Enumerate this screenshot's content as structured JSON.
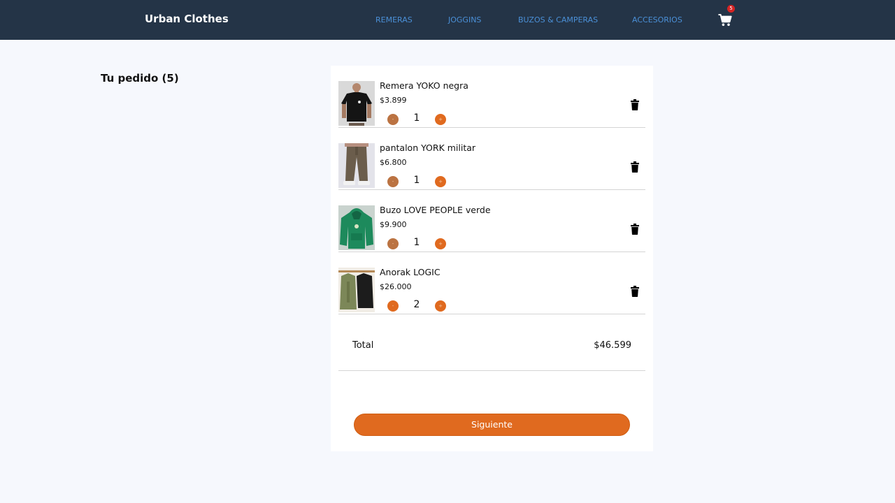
{
  "navbar": {
    "brand": "Urban Clothes",
    "links": [
      "REMERAS",
      "JOGGINS",
      "BUZOS & CAMPERAS",
      "ACCESORIOS"
    ],
    "cart_count": "5"
  },
  "order": {
    "title": "Tu pedido (5)",
    "items": [
      {
        "name": "Remera YOKO negra",
        "price": "$3.899",
        "quantity": "1",
        "minus": "-",
        "plus": "+"
      },
      {
        "name": "pantalon YORK militar",
        "price": "$6.800",
        "quantity": "1",
        "minus": "-",
        "plus": "+"
      },
      {
        "name": "Buzo LOVE PEOPLE verde",
        "price": "$9.900",
        "quantity": "1",
        "minus": "-",
        "plus": "+"
      },
      {
        "name": "Anorak LOGIC",
        "price": "$26.000",
        "quantity": "2",
        "minus": "-",
        "plus": "+"
      }
    ],
    "total_label": "Total",
    "total_value": "$46.599",
    "next_label": "Siguiente"
  },
  "icons": {
    "cart": "cart-icon",
    "delete": "trash-icon"
  },
  "colors": {
    "navbar": "#243447",
    "nav_link": "#4a8fd6",
    "accent": "#e06a1f",
    "minus_button": "#bb7342",
    "badge": "#d62424",
    "background": "#f6f8fd"
  }
}
